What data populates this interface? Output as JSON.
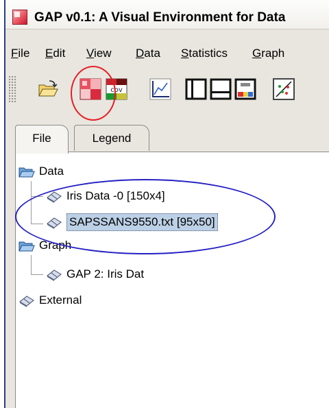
{
  "window": {
    "title": "GAP v0.1: A Visual Environment for Data"
  },
  "menu": {
    "items": [
      {
        "label": "File",
        "mnemonic": "F",
        "rest": "ile"
      },
      {
        "label": "Edit",
        "mnemonic": "E",
        "rest": "dit"
      },
      {
        "label": "View",
        "mnemonic": "V",
        "rest": "iew"
      },
      {
        "label": "Data",
        "mnemonic": "D",
        "rest": "ata"
      },
      {
        "label": "Statistics",
        "mnemonic": "S",
        "rest": "tatistics"
      },
      {
        "label": "Graph",
        "mnemonic": "G",
        "rest": "raph"
      }
    ]
  },
  "toolbar": {
    "buttons": [
      {
        "name": "open-folder-icon"
      },
      {
        "name": "correlation-matrix-icon"
      },
      {
        "name": "covariance-matrix-icon",
        "text": "cov"
      },
      {
        "name": "line-plot-icon"
      },
      {
        "name": "layout-split-vertical-icon"
      },
      {
        "name": "layout-split-horizontal-icon"
      },
      {
        "name": "color-bar-icon"
      },
      {
        "name": "scatter-plot-icon"
      }
    ]
  },
  "tabs": [
    {
      "label": "File",
      "active": true
    },
    {
      "label": "Legend",
      "active": false
    }
  ],
  "tree": {
    "data_label": "Data",
    "data_children": [
      "Iris Data -0 [150x4]",
      "SAPSSANS9550.txt [95x50]"
    ],
    "graph_label": "Graph",
    "graph_children": [
      "GAP 2: Iris Dat"
    ],
    "external_label": "External"
  },
  "colors": {
    "annotation_red": "#e81c23",
    "annotation_blue": "#2420c4",
    "selection": "#bcd0e6"
  }
}
